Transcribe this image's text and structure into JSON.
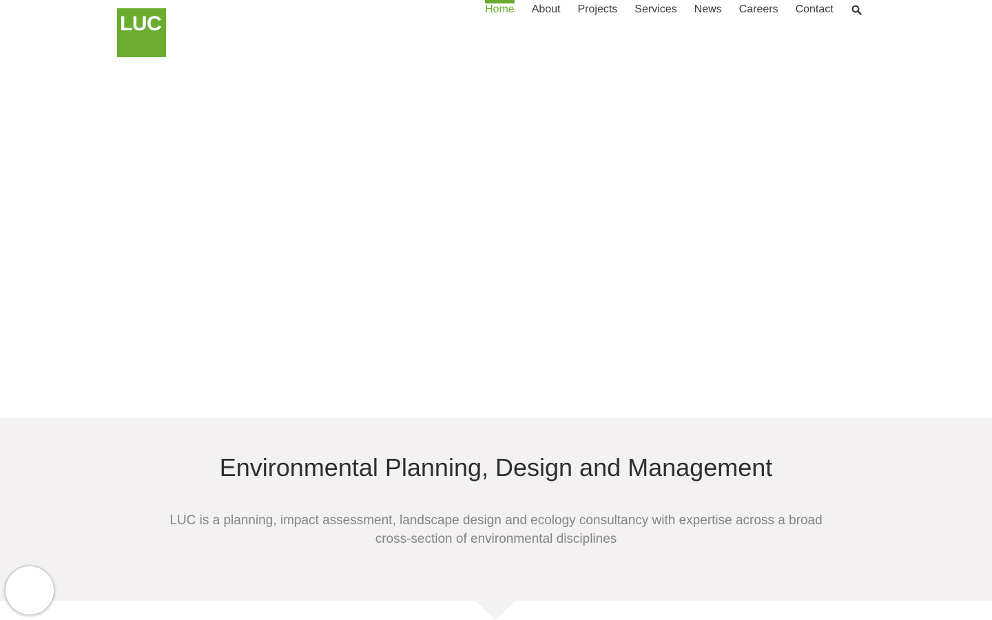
{
  "brand": {
    "logo_text": "LUC",
    "accent_color": "#6aad2e"
  },
  "nav": {
    "items": [
      {
        "label": "Home",
        "active": true
      },
      {
        "label": "About",
        "active": false
      },
      {
        "label": "Projects",
        "active": false
      },
      {
        "label": "Services",
        "active": false
      },
      {
        "label": "News",
        "active": false
      },
      {
        "label": "Careers",
        "active": false
      },
      {
        "label": "Contact",
        "active": false
      }
    ],
    "search_icon": "search-icon"
  },
  "intro": {
    "title": "Environmental Planning, Design and Management",
    "text": "LUC is a planning, impact assessment, landscape design and ecology consultancy with expertise across a broad cross-section of environmental disciplines",
    "background_color": "#f3f1f2"
  },
  "chat_widget": {
    "icon": "chat-bubble-icon"
  }
}
